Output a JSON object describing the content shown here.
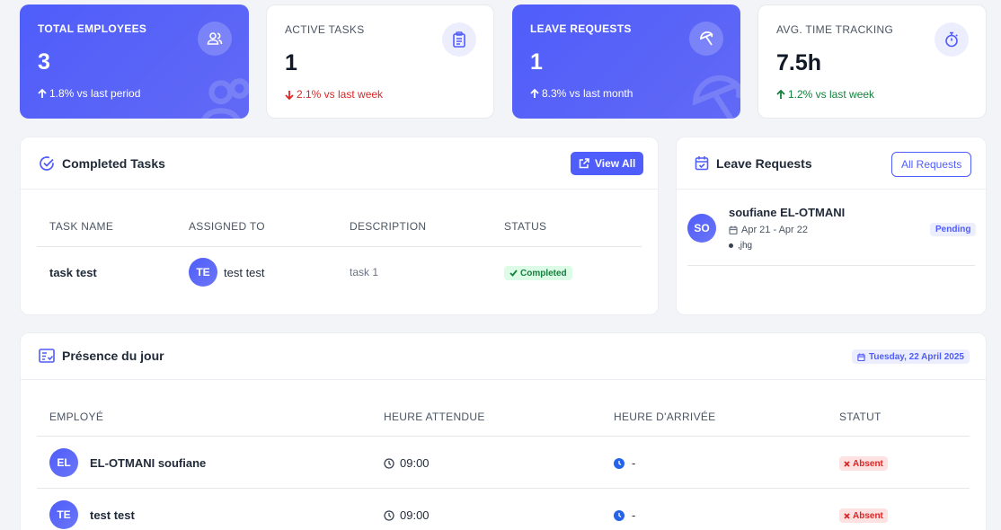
{
  "stats": [
    {
      "label": "TOTAL EMPLOYEES",
      "value": "3",
      "trend": "1.8% vs last period",
      "trend_dir": "up",
      "icon": "users-icon"
    },
    {
      "label": "ACTIVE TASKS",
      "value": "1",
      "trend": "2.1% vs last week",
      "trend_dir": "down",
      "icon": "clipboard-icon"
    },
    {
      "label": "LEAVE REQUESTS",
      "value": "1",
      "trend": "8.3% vs last month",
      "trend_dir": "up",
      "icon": "umbrella-beach-icon"
    },
    {
      "label": "AVG. TIME TRACKING",
      "value": "7.5h",
      "trend": "1.2% vs last week",
      "trend_dir": "up",
      "icon": "stopwatch-icon"
    }
  ],
  "completed_tasks": {
    "title": "Completed Tasks",
    "view_all": "View All",
    "columns": [
      "TASK NAME",
      "ASSIGNED TO",
      "DESCRIPTION",
      "STATUS"
    ],
    "rows": [
      {
        "task": "task test",
        "initials": "TE",
        "assignee": "test test",
        "description": "task 1",
        "status": "Completed"
      }
    ]
  },
  "leave_requests": {
    "title": "Leave Requests",
    "all_button": "All Requests",
    "items": [
      {
        "initials": "SO",
        "name": "soufiane EL-OTMANI",
        "dates": "Apr 21 - Apr 22",
        "reason": ",jhg",
        "status": "Pending"
      }
    ]
  },
  "presence": {
    "title": "Présence du jour",
    "date": "Tuesday, 22 April 2025",
    "columns": [
      "EMPLOYÉ",
      "HEURE ATTENDUE",
      "HEURE D'ARRIVÉE",
      "STATUT"
    ],
    "rows": [
      {
        "initials": "EL",
        "name": "EL-OTMANI soufiane",
        "expected": "09:00",
        "arrival": "-",
        "status": "Absent"
      },
      {
        "initials": "TE",
        "name": "test test",
        "expected": "09:00",
        "arrival": "-",
        "status": "Absent"
      }
    ]
  },
  "colors": {
    "primary": "#4f5dfa",
    "success": "#15803d",
    "danger": "#dc2626"
  }
}
